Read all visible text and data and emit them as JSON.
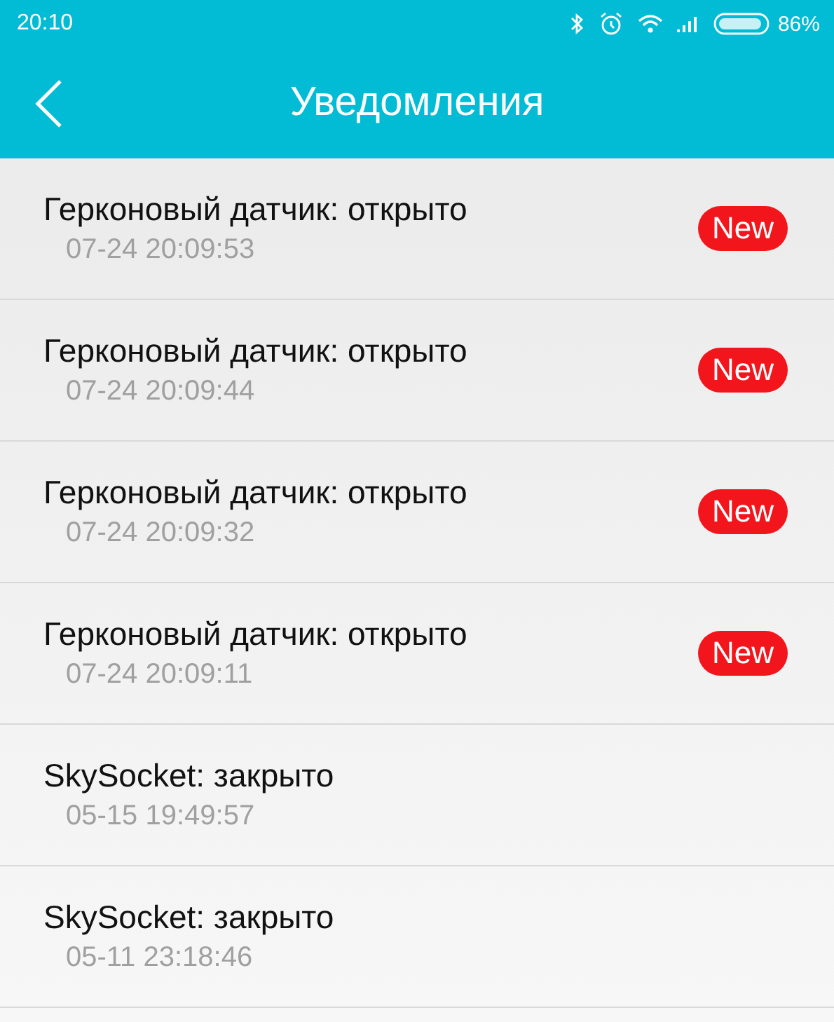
{
  "status_bar": {
    "time": "20:10",
    "battery_text": "86%"
  },
  "header": {
    "title": "Уведомления"
  },
  "notifications": [
    {
      "title": "Герконовый датчик: открыто",
      "time": "07-24 20:09:53",
      "badge": "New"
    },
    {
      "title": "Герконовый датчик: открыто",
      "time": "07-24 20:09:44",
      "badge": "New"
    },
    {
      "title": "Герконовый датчик: открыто",
      "time": "07-24 20:09:32",
      "badge": "New"
    },
    {
      "title": "Герконовый датчик: открыто",
      "time": "07-24 20:09:11",
      "badge": "New"
    },
    {
      "title": "SkySocket: закрыто",
      "time": "05-15 19:49:57"
    },
    {
      "title": "SkySocket: закрыто",
      "time": "05-11 23:18:46"
    }
  ]
}
